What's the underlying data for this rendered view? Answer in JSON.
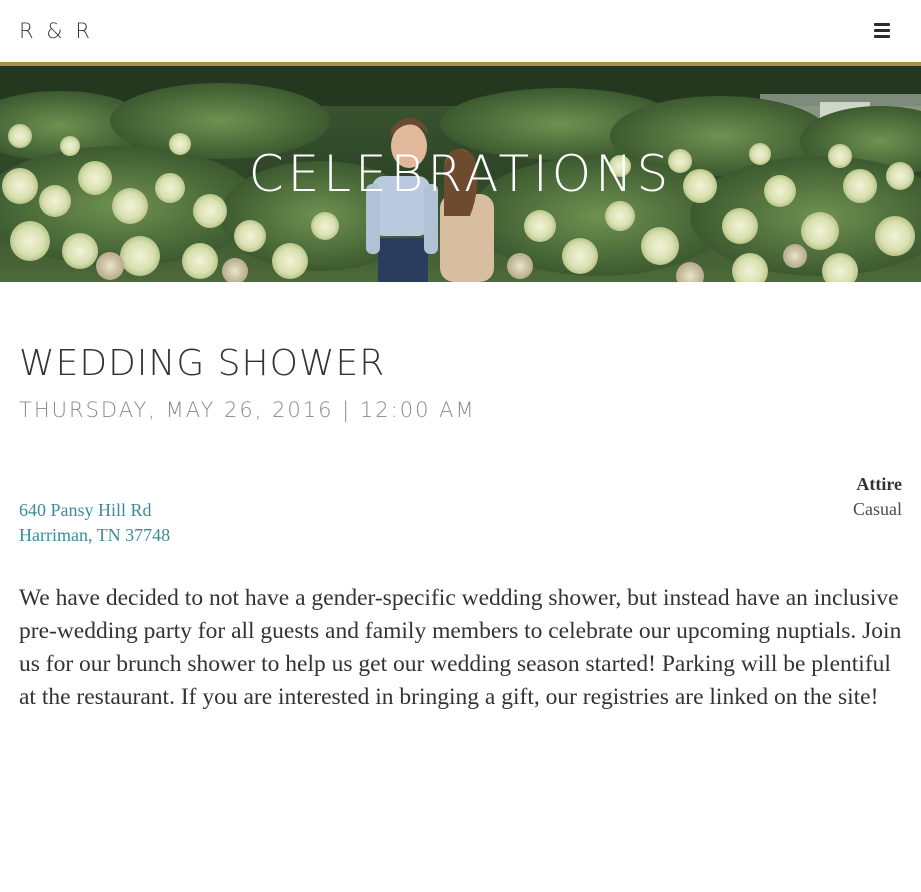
{
  "header": {
    "logo": "R & R",
    "menu_icon": "hamburger-menu-icon",
    "accent_color": "#a3963f"
  },
  "hero": {
    "title": "CELEBRATIONS"
  },
  "event": {
    "title": "WEDDING SHOWER",
    "date": "THURSDAY, MAY 26, 2016 | 12:00 AM",
    "address_line1": "640 Pansy Hill Rd",
    "address_line2": "Harriman, TN 37748",
    "address_color": "#3a8c9a",
    "attire_label": "Attire",
    "attire_value": "Casual",
    "description": "We have decided to not have a gender-specific wedding shower, but instead have an inclusive pre-wedding party for all guests and family members to celebrate our upcoming nuptials. Join us for our brunch shower to help us get our wedding season started! Parking will be plentiful at the restaurant. If you are interested in bringing a gift, our registries are linked on the site!"
  }
}
